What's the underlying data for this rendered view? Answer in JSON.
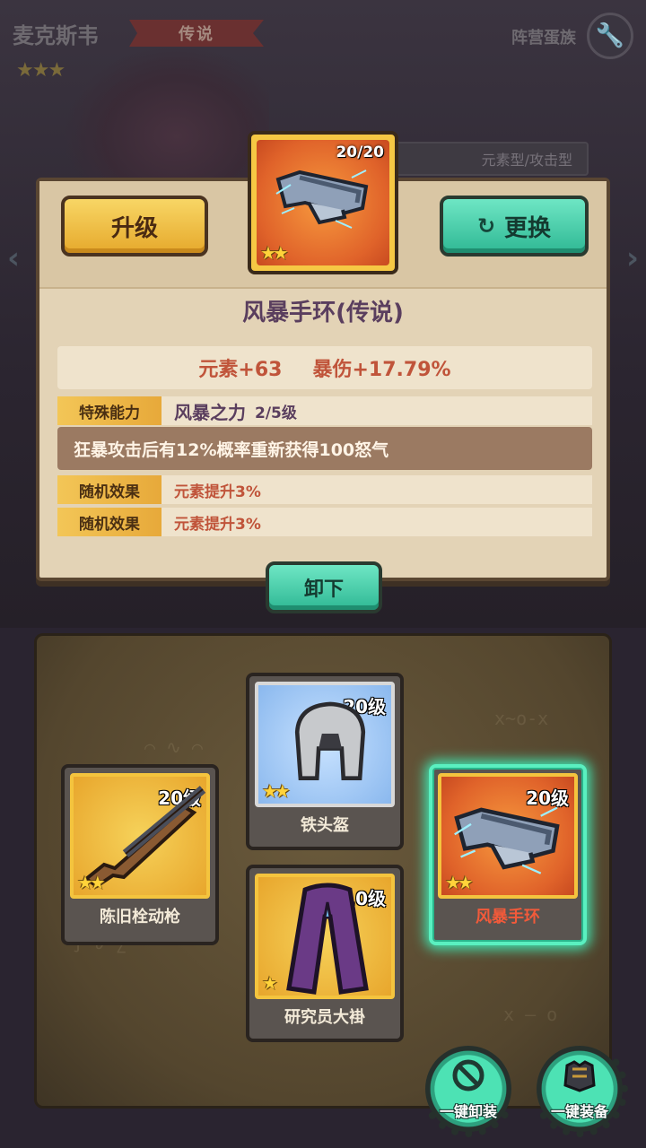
{
  "hero": {
    "name": "麦克斯韦",
    "rarity": "传说",
    "stars": "★★★",
    "faction": "阵营蛋族",
    "type": "元素型/攻击型"
  },
  "featured_item": {
    "count": "20/20",
    "stars": "★★",
    "title": "风暴手环(传说)"
  },
  "detail": {
    "upgrade_label": "升级",
    "replace_label": "更换",
    "stat_1": "元素+63",
    "stat_2": "暴伤+17.79%",
    "special_tag": "特殊能力",
    "special_name": "风暴之力",
    "special_level": "2/5级",
    "special_desc": "狂暴攻击后有12%概率重新获得100怒气",
    "random_tag_1": "随机效果",
    "random_value_1": "元素提升3%",
    "random_tag_2": "随机效果",
    "random_value_2": "元素提升3%",
    "unequip_label": "卸下"
  },
  "slots": [
    {
      "name": "陈旧栓动枪",
      "level": "20级",
      "stars": "★★"
    },
    {
      "name": "铁头盔",
      "level": "20级",
      "stars": "★★"
    },
    {
      "name": "研究员大褂",
      "level": "10级",
      "stars": "★"
    },
    {
      "name": "风暴手环",
      "level": "20级",
      "stars": "★★"
    }
  ],
  "actions": {
    "unequip_all": "一键卸装",
    "equip_all": "一键装备"
  },
  "colors": {
    "accent_gold": "#f4c43e",
    "accent_teal": "#3fe8b4",
    "stat_red": "#c0543a",
    "title_purple": "#5a3e5e"
  }
}
